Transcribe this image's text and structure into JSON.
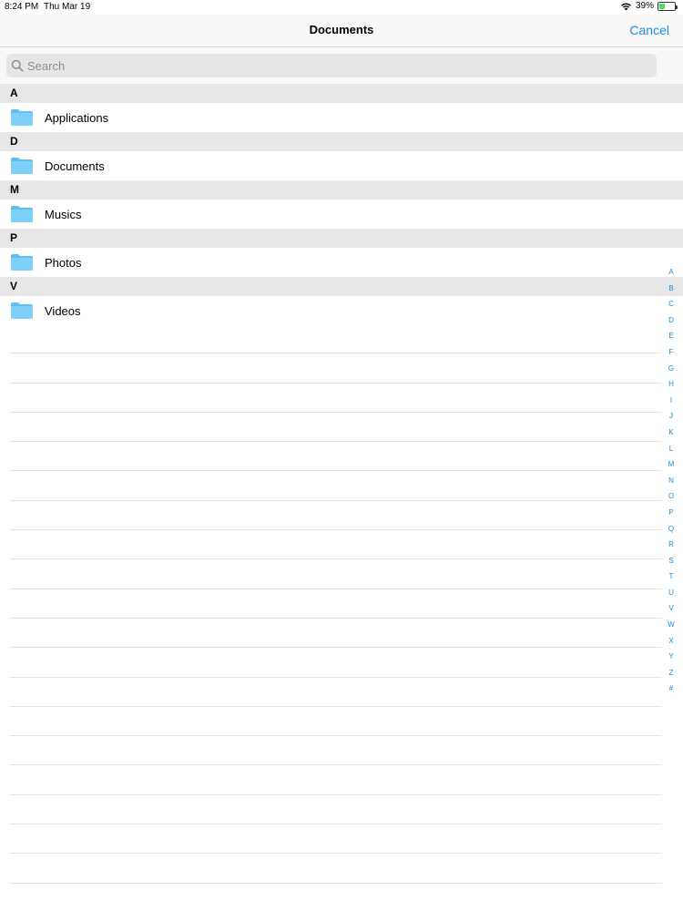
{
  "status_bar": {
    "time": "8:24 PM",
    "date": "Thu Mar 19",
    "battery_percent": "39%",
    "battery_level": 0.39,
    "icons": [
      "wifi-icon",
      "battery-icon"
    ]
  },
  "nav": {
    "title": "Documents",
    "cancel_label": "Cancel"
  },
  "search": {
    "placeholder": "Search",
    "value": ""
  },
  "sections": [
    {
      "header": "A",
      "items": [
        {
          "label": "Applications",
          "icon": "folder-icon"
        }
      ]
    },
    {
      "header": "D",
      "items": [
        {
          "label": "Documents",
          "icon": "folder-icon"
        }
      ]
    },
    {
      "header": "M",
      "items": [
        {
          "label": "Musics",
          "icon": "folder-icon"
        }
      ]
    },
    {
      "header": "P",
      "items": [
        {
          "label": "Photos",
          "icon": "folder-icon"
        }
      ]
    },
    {
      "header": "V",
      "items": [
        {
          "label": "Videos",
          "icon": "folder-icon"
        }
      ]
    }
  ],
  "index": [
    "A",
    "B",
    "C",
    "D",
    "E",
    "F",
    "G",
    "H",
    "I",
    "J",
    "K",
    "L",
    "M",
    "N",
    "O",
    "P",
    "Q",
    "R",
    "S",
    "T",
    "U",
    "V",
    "W",
    "X",
    "Y",
    "Z",
    "#"
  ],
  "colors": {
    "accent": "#1a8cdc",
    "folder": "#7fd0f7",
    "section_bg": "#e7e7e7",
    "battery_fill": "#4cd964"
  }
}
